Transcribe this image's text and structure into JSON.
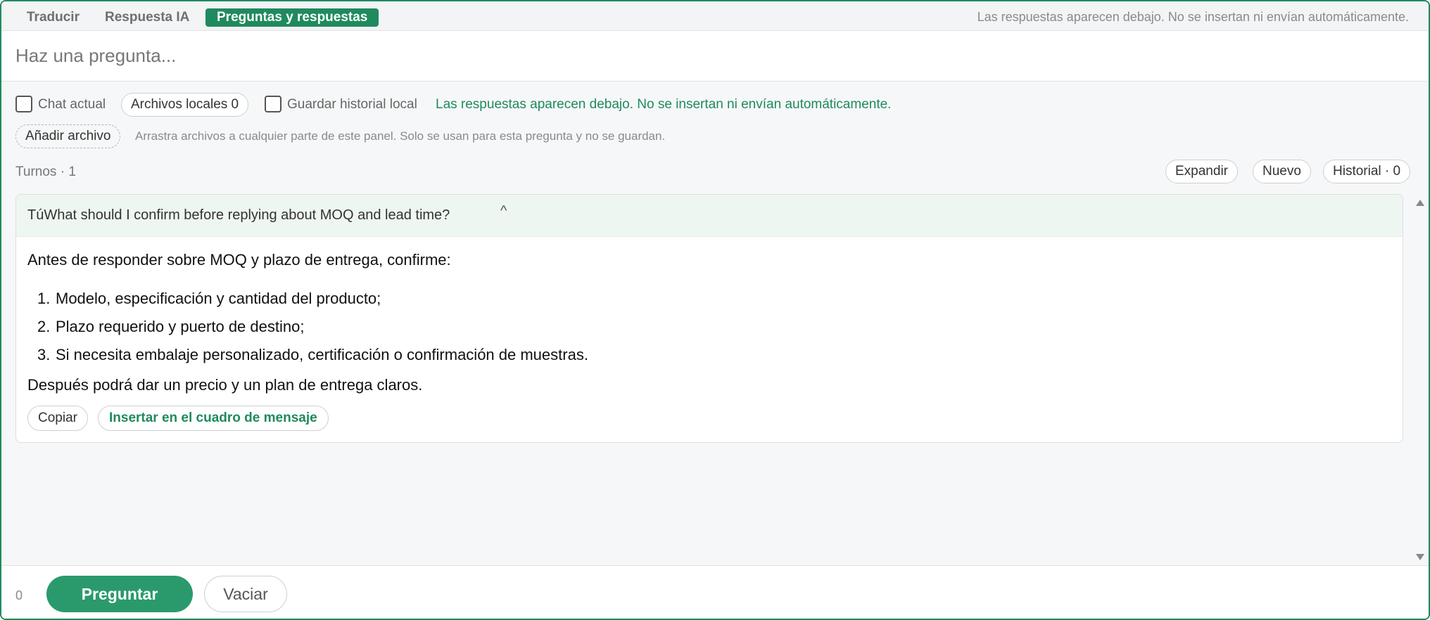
{
  "tabs": {
    "items": [
      {
        "label": "Traducir"
      },
      {
        "label": "Respuesta IA"
      },
      {
        "label": "Preguntas y respuestas"
      }
    ],
    "active_index": 2,
    "note": "Las respuestas aparecen debajo. No se insertan ni envían automáticamente."
  },
  "question": {
    "placeholder": "Haz una pregunta...",
    "value": ""
  },
  "options": {
    "chat_actual": {
      "label": "Chat actual",
      "checked": false
    },
    "local_files": {
      "label": "Archivos locales 0"
    },
    "save_history": {
      "label": "Guardar historial local",
      "checked": false
    },
    "note": "Las respuestas aparecen debajo. No se insertan ni envían automáticamente.",
    "add_file": {
      "label": "Añadir archivo"
    },
    "drop_hint": "Arrastra archivos a cualquier parte de este panel. Solo se usan para esta pregunta y no se guardan."
  },
  "turns": {
    "label": "Turnos · 1",
    "expand_label": "Expandir",
    "new_label": "Nuevo",
    "history_label": "Historial · 0"
  },
  "turn": {
    "question_text": "TúWhat should I confirm before replying about MOQ and lead time?",
    "caret": "^",
    "answer_intro": "Antes de responder sobre MOQ y plazo de entrega, confirme:",
    "answer_items": [
      {
        "num": "1.",
        "text": "Modelo, especificación y cantidad del producto;"
      },
      {
        "num": "2.",
        "text": "Plazo requerido y puerto de destino;"
      },
      {
        "num": "3.",
        "text": "Si necesita embalaje personalizado, certificación o confirmación de muestras."
      }
    ],
    "answer_outro": "Después podrá dar un precio y un plan de entrega claros.",
    "copy_label": "Copiar",
    "insert_label": "Insertar en el cuadro de mensaje"
  },
  "footer": {
    "char_count": "0",
    "ask_label": "Preguntar",
    "clear_label": "Vaciar"
  },
  "colors": {
    "accent": "#1f8a5e",
    "ask_button": "#2a9a6c",
    "card_header": "#eef6f1"
  }
}
